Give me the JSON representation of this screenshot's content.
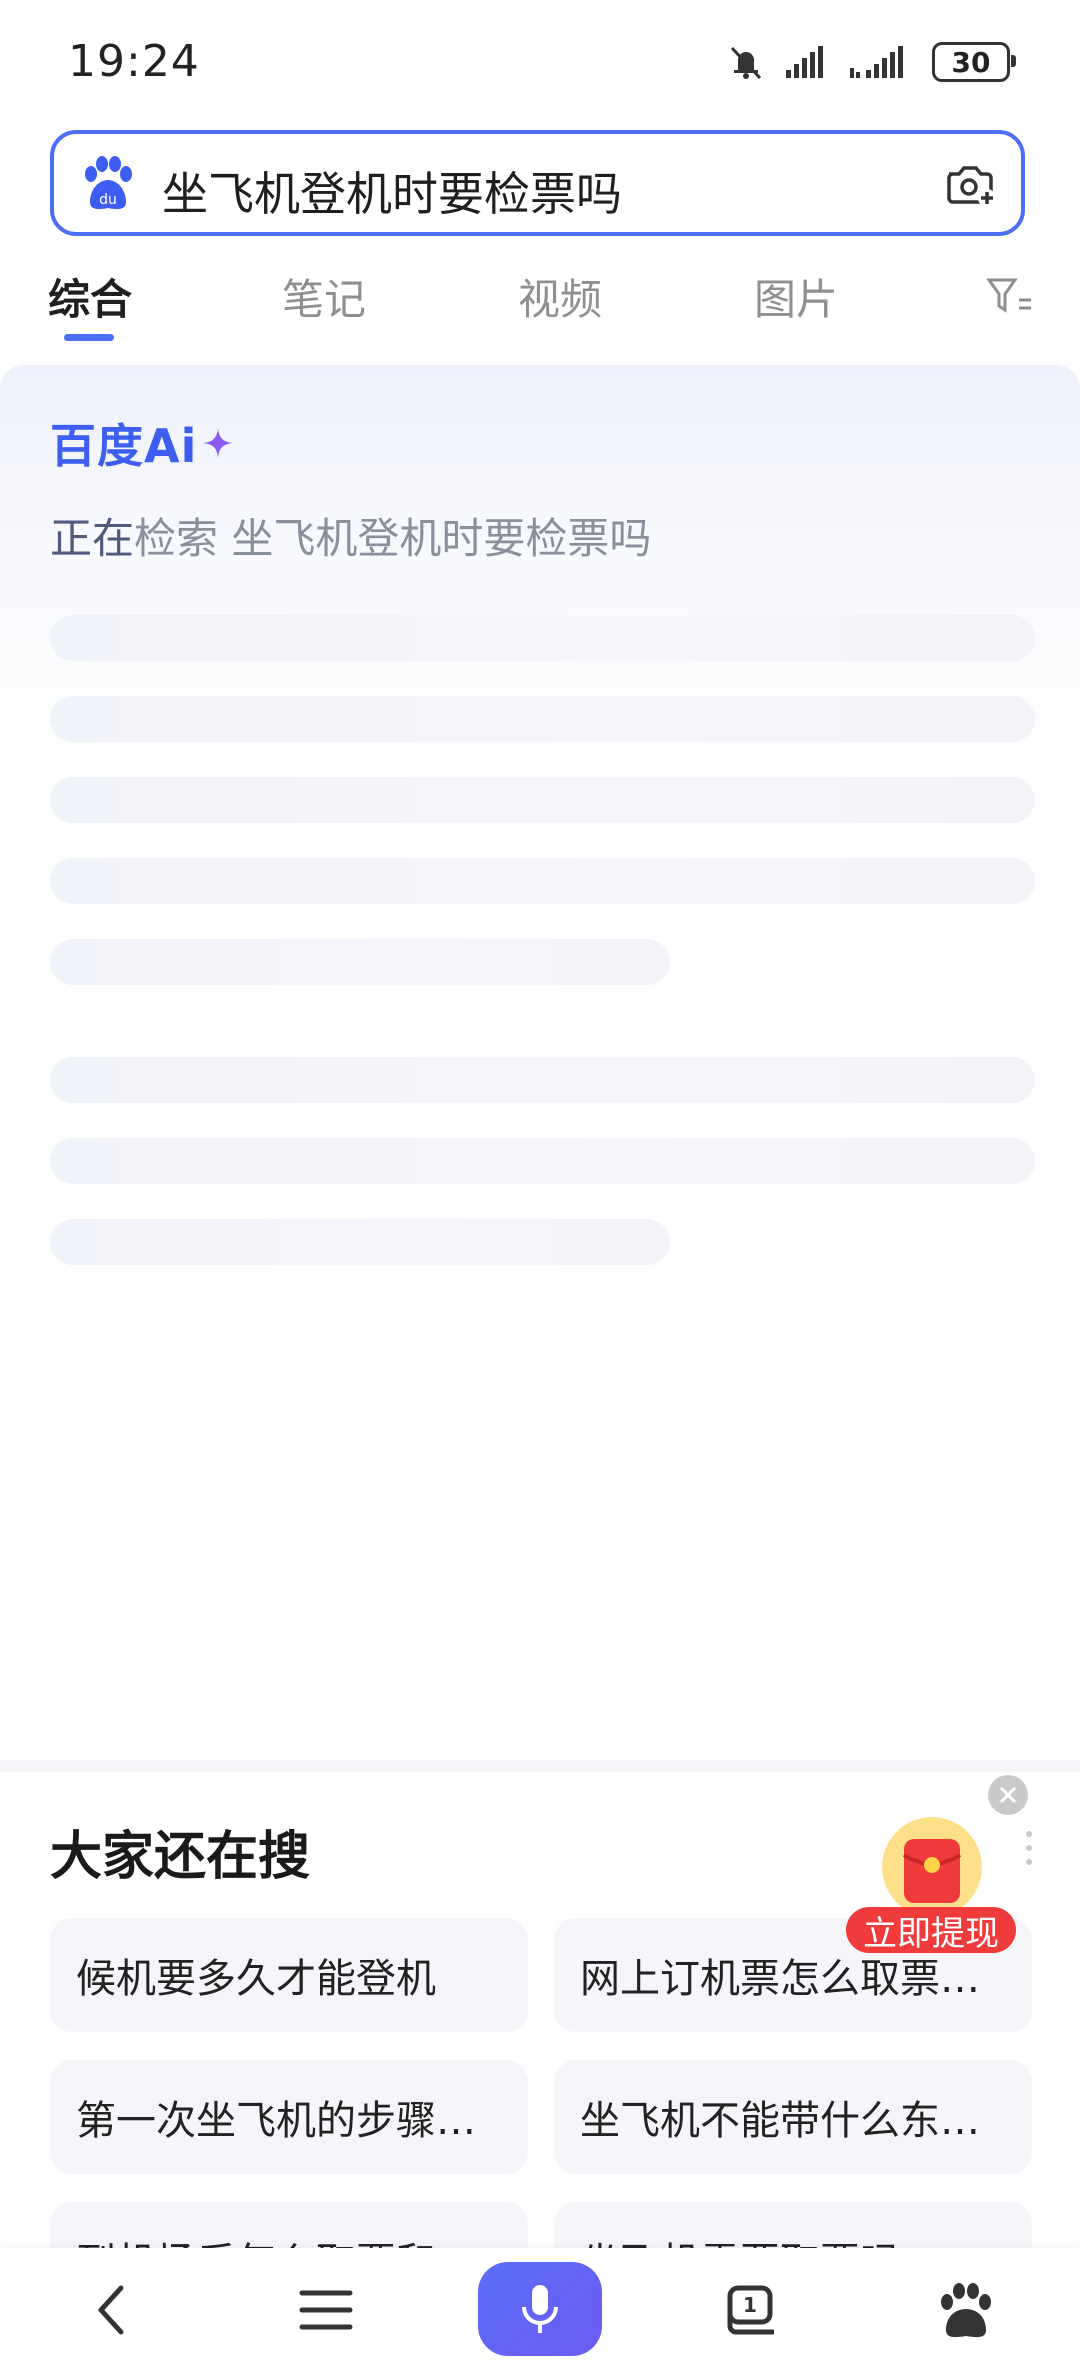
{
  "status_bar": {
    "time": "19:24",
    "battery": "30"
  },
  "search": {
    "query": "坐飞机登机时要检票吗"
  },
  "tabs": [
    {
      "label": "综合"
    },
    {
      "label": "笔记"
    },
    {
      "label": "视频"
    },
    {
      "label": "图片"
    }
  ],
  "ai_card": {
    "logo_text": "百度Ai",
    "status_lead": "正在",
    "status_rest": "检索 坐飞机登机时要检票吗"
  },
  "related": {
    "title": "大家还在搜",
    "items": [
      "候机要多久才能登机",
      "网上订机票怎么取票…",
      "第一次坐飞机的步骤…",
      "坐飞机不能带什么东…",
      "到机场后怎么取票和…",
      "坐飞机需要取票吗"
    ]
  },
  "promo": {
    "label": "立即提现"
  },
  "colors": {
    "accent": "#4e6ef2",
    "promo_red": "#ef3b3b"
  }
}
